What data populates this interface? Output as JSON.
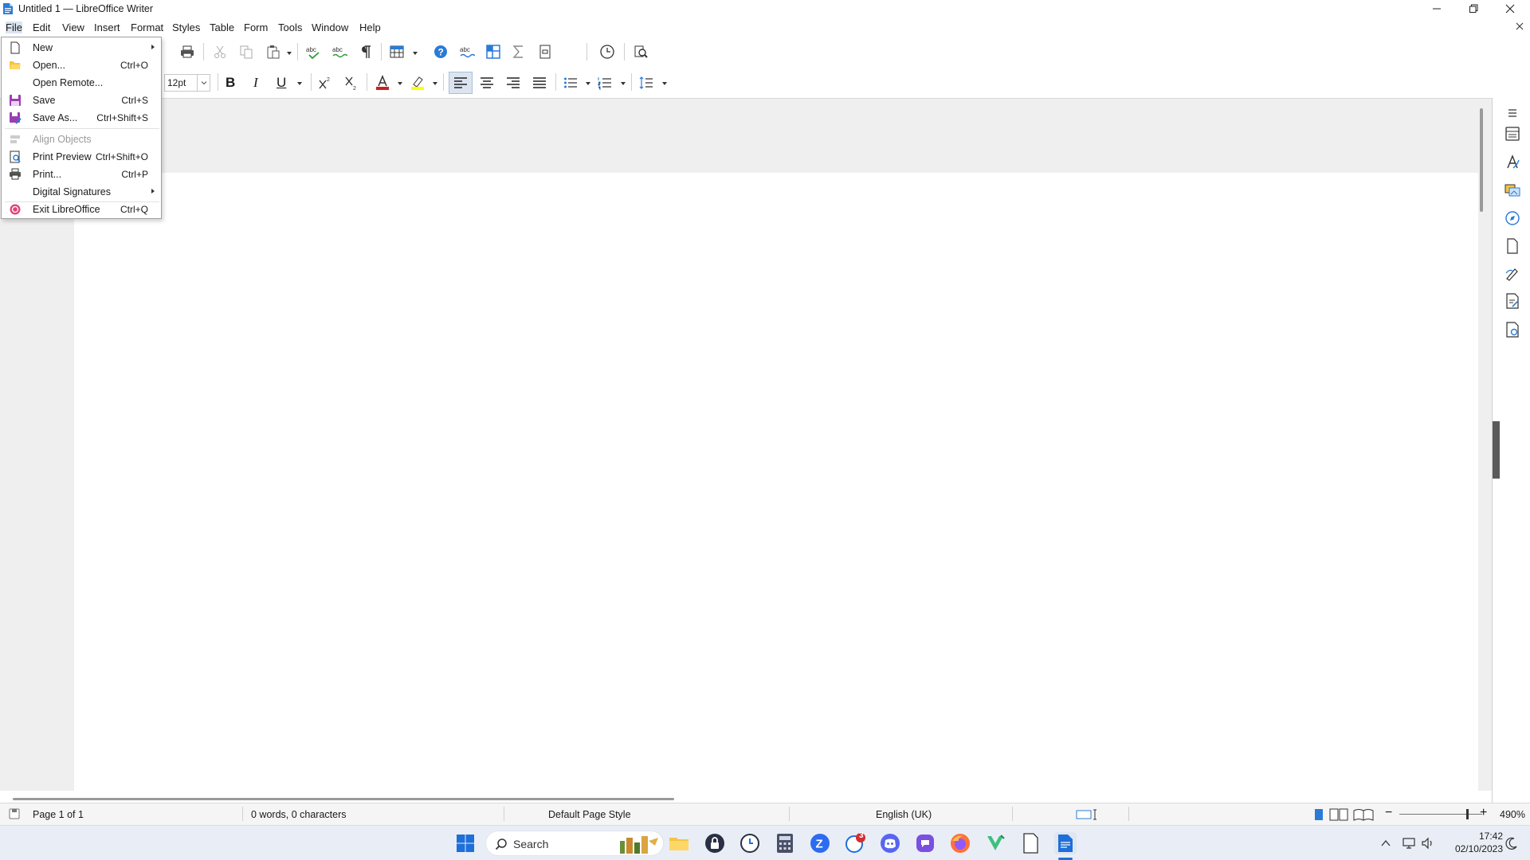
{
  "window": {
    "title": "Untitled 1 — LibreOffice Writer"
  },
  "menubar": [
    "File",
    "Edit",
    "View",
    "Insert",
    "Format",
    "Styles",
    "Table",
    "Form",
    "Tools",
    "Window",
    "Help"
  ],
  "file_menu": {
    "items": [
      {
        "label": "New",
        "shortcut": "",
        "submenu": true,
        "icon": "new-document-icon"
      },
      {
        "label": "Open...",
        "shortcut": "Ctrl+O",
        "icon": "open-folder-icon"
      },
      {
        "label": "Open Remote...",
        "shortcut": ""
      },
      {
        "label": "Save",
        "shortcut": "Ctrl+S",
        "icon": "save-icon"
      },
      {
        "label": "Save As...",
        "shortcut": "Ctrl+Shift+S",
        "icon": "save-as-icon"
      },
      {
        "label": "Align Objects",
        "shortcut": "",
        "disabled": true,
        "icon": "align-objects-icon"
      },
      {
        "label": "Print Preview",
        "shortcut": "Ctrl+Shift+O",
        "icon": "print-preview-icon"
      },
      {
        "label": "Print...",
        "shortcut": "Ctrl+P",
        "icon": "printer-icon"
      },
      {
        "label": "Digital Signatures",
        "shortcut": "",
        "submenu": true
      },
      {
        "label": "Exit LibreOffice",
        "shortcut": "Ctrl+Q",
        "icon": "exit-icon"
      }
    ]
  },
  "toolbar": {
    "font_size": "12pt",
    "bold": "B",
    "italic": "I",
    "underline": "U"
  },
  "statusbar": {
    "page": "Page 1 of 1",
    "words": "0 words, 0 characters",
    "page_style": "Default Page Style",
    "language": "English (UK)",
    "zoom": "490%"
  },
  "taskbar": {
    "search_label": "Search",
    "time": "17:42",
    "date": "02/10/2023",
    "mail_badge": "3"
  },
  "colors": {
    "accent": "#1e6fd9",
    "font_color_bar": "#c9211e",
    "highlight_bar": "#ffff00"
  }
}
